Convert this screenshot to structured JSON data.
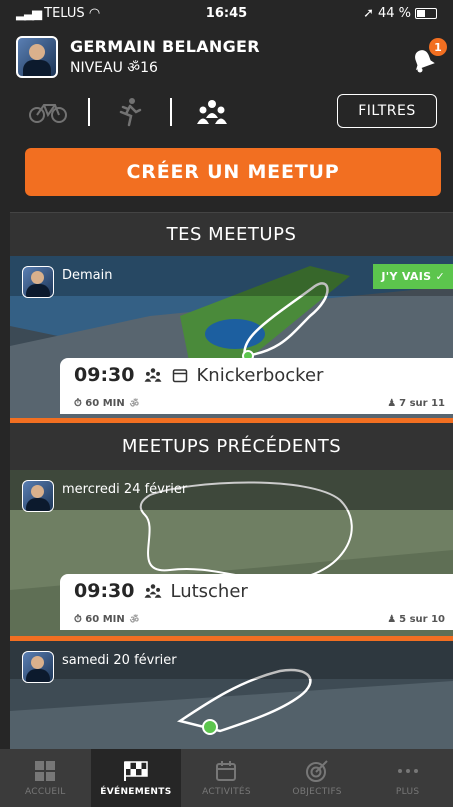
{
  "status": {
    "carrier": "TELUS",
    "time": "16:45",
    "battery": "44 %"
  },
  "profile": {
    "name": "GERMAIN BELANGER",
    "level": "NIVEAU ॐ16",
    "notifications": "1"
  },
  "filters_label": "FILTRES",
  "create_label": "CRÉER UN MEETUP",
  "sections": {
    "mine": "TES MEETUPS",
    "previous": "MEETUPS PRÉCÉDENTS"
  },
  "my_meetups": [
    {
      "date": "Demain",
      "badge": "J'Y VAIS ✓",
      "time": "09:30",
      "name": "Knickerbocker",
      "duration": "60 MIN",
      "participants": "7 sur 11"
    }
  ],
  "previous_meetups": [
    {
      "date": "mercredi 24 février",
      "time": "09:30",
      "name": "Lutscher",
      "duration": "60 MIN",
      "participants": "5 sur 10"
    },
    {
      "date": "samedi 20 février"
    }
  ],
  "nav": [
    "ACCUEIL",
    "ÉVÉNEMENTS",
    "ACTIVITÉS",
    "OBJECTIFS",
    "PLUS"
  ],
  "colors": {
    "accent": "#f26f21",
    "going": "#5cc54d",
    "background": "#262626"
  }
}
